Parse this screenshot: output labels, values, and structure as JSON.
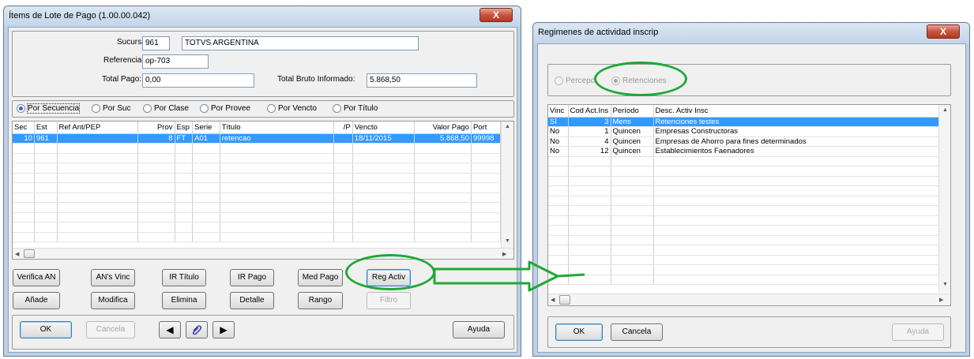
{
  "left": {
    "title": "Ítems de Lote de Pago (1.00.00.042)",
    "close": "X",
    "sucursal_label": "Sucursal:",
    "sucursal_code": "961",
    "sucursal_name": "TOTVS ARGENTINA",
    "referencia_label": "Referencia:",
    "referencia_value": "op-703",
    "total_pago_label": "Total Pago:",
    "total_pago_value": "0,00",
    "total_bruto_label": "Total Bruto Informado:",
    "total_bruto_value": "5.868,50",
    "radios": [
      "Por Secuencia",
      "Por Suc",
      "Por Clase",
      "Por Provee",
      "Por Vencto",
      "Por Título"
    ],
    "selected_radio": 0,
    "columns": [
      "Sec",
      "Est",
      "Ref Ant/PEP",
      "Prov",
      "Esp",
      "Serie",
      "Título",
      "/P",
      "Vencto",
      "Valor Pago",
      "Port"
    ],
    "rows": [
      [
        "10",
        "961",
        "",
        "8",
        "FT",
        "A01",
        "retencao",
        "",
        "18/11/2015",
        "5.868,50",
        "99998"
      ]
    ],
    "buttons_row1": [
      "Verifica AN",
      "AN's Vinc",
      "IR Título",
      "IR Pago",
      "Med Pago",
      "Reg Activ"
    ],
    "buttons_row2": [
      "Añade",
      "Modifica",
      "Elimina",
      "Detalle",
      "Rango",
      "Filtro"
    ],
    "ok": "OK",
    "cancel": "Cancela",
    "help": "Ayuda"
  },
  "right": {
    "title": "Regimenes de actividad inscrip",
    "close": "X",
    "radios": [
      "Percepc",
      "Retenciones"
    ],
    "selected_radio": 1,
    "columns": [
      "Vinc",
      "Cod Act.Ins",
      "Período",
      "Desc. Activ Insc"
    ],
    "rows": [
      [
        "SÍ",
        "3",
        "Mens",
        "Retenciones testes"
      ],
      [
        "No",
        "1",
        "Quincen",
        "Empresas Constructoras"
      ],
      [
        "No",
        "4",
        "Quincen",
        "Empresas de Ahorro para fines determinados"
      ],
      [
        "No",
        "12",
        "Quincen",
        "Establecimientos Faenadores"
      ]
    ],
    "ok": "OK",
    "cancel": "Cancela",
    "help": "Ayuda"
  },
  "colors": {
    "highlight": "#3399ff",
    "annotation": "#21a836",
    "window_frame": "#bcd0e6"
  }
}
